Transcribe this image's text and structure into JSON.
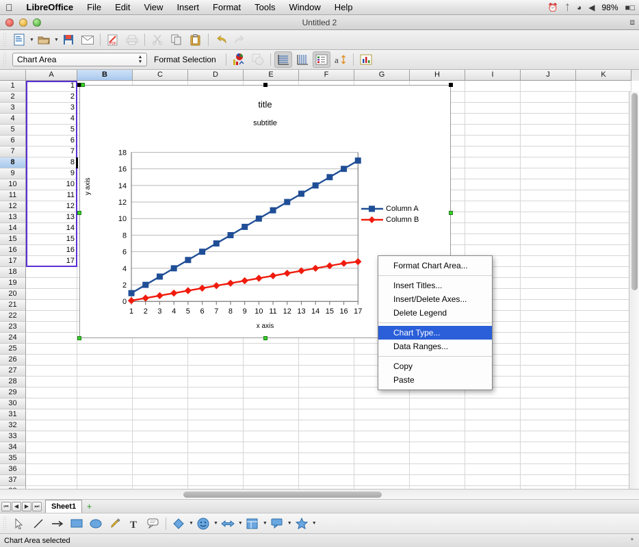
{
  "macmenu": {
    "apple": "&#63743;",
    "items": [
      {
        "label": "LibreOffice",
        "bold": true
      },
      {
        "label": "File",
        "bold": false
      },
      {
        "label": "Edit",
        "bold": false
      },
      {
        "label": "View",
        "bold": false
      },
      {
        "label": "Insert",
        "bold": false
      },
      {
        "label": "Format",
        "bold": false
      },
      {
        "label": "Tools",
        "bold": false
      },
      {
        "label": "Window",
        "bold": false
      },
      {
        "label": "Help",
        "bold": false
      }
    ],
    "status_icons": [
      "time-machine-icon",
      "bluetooth-icon",
      "wifi-icon",
      "volume-icon"
    ],
    "battery_percent": "98%"
  },
  "window": {
    "title": "Untitled 2",
    "traffic_lights": [
      "close-button",
      "minimize-button",
      "zoom-button"
    ],
    "fullscreen_icon": "fullscreen-icon"
  },
  "toolbar_main": {
    "buttons": [
      {
        "name": "new-document-button",
        "icon": "new-doc-icon",
        "dropdown": true
      },
      {
        "name": "open-document-button",
        "icon": "folder-icon",
        "dropdown": true
      },
      {
        "name": "save-button",
        "icon": "floppy-disk-icon",
        "dropdown": false
      },
      {
        "name": "email-button",
        "icon": "envelope-icon",
        "dropdown": false
      },
      {
        "name": "export-pdf-button",
        "icon": "pdf-icon",
        "dropdown": false
      },
      {
        "name": "print-button",
        "icon": "printer-icon",
        "dropdown": false
      },
      {
        "name": "cut-button",
        "icon": "scissors-icon",
        "dropdown": false
      },
      {
        "name": "copy-button",
        "icon": "copy-icon",
        "dropdown": false
      },
      {
        "name": "paste-button",
        "icon": "clipboard-icon",
        "dropdown": false
      },
      {
        "name": "undo-button",
        "icon": "undo-arrow-icon",
        "dropdown": false
      },
      {
        "name": "redo-button",
        "icon": "redo-arrow-icon",
        "dropdown": false
      }
    ]
  },
  "toolbar_chart": {
    "selection_value": "Chart Area",
    "format_selection_label": "Format Selection",
    "buttons": [
      {
        "name": "chart-data-table-button",
        "icon": "chart-colors-icon"
      },
      {
        "name": "chart-3d-view-button",
        "icon": "overlap-shapes-icon"
      },
      {
        "name": "horizontal-grids-button",
        "icon": "horizontal-grid-icon",
        "pressed": true
      },
      {
        "name": "vertical-grids-button",
        "icon": "vertical-grid-icon",
        "pressed": false
      },
      {
        "name": "legend-on-off-button",
        "icon": "legend-icon",
        "pressed": true
      },
      {
        "name": "text-direction-button",
        "icon": "text-vertical-icon",
        "pressed": false
      },
      {
        "name": "chart-type-button",
        "icon": "bar-chart-icon",
        "pressed": false
      }
    ]
  },
  "spreadsheet": {
    "columns": [
      "A",
      "B",
      "C",
      "D",
      "E",
      "F",
      "G",
      "H",
      "I",
      "J",
      "K"
    ],
    "active_column": "B",
    "active_row": 8,
    "first_row": 1,
    "last_row": 38,
    "column_a_values": [
      "1",
      "2",
      "3",
      "4",
      "5",
      "6",
      "7",
      "8",
      "9",
      "10",
      "11",
      "12",
      "13",
      "14",
      "15",
      "16",
      "17"
    ]
  },
  "chart_data": {
    "type": "line",
    "title": "title",
    "subtitle": "subtitle",
    "xlabel": "x axis",
    "ylabel": "y axis",
    "grid": "horizontal",
    "legend_position": "right",
    "x": [
      1,
      2,
      3,
      4,
      5,
      6,
      7,
      8,
      9,
      10,
      11,
      12,
      13,
      14,
      15,
      16,
      17
    ],
    "xlim": [
      1,
      17
    ],
    "ylim": [
      0,
      18
    ],
    "yticks": [
      0,
      2,
      4,
      6,
      8,
      10,
      12,
      14,
      16,
      18
    ],
    "series": [
      {
        "name": "Column A",
        "color": "#1f4e96",
        "marker": "square",
        "values": [
          1,
          2,
          3,
          4,
          5,
          6,
          7,
          8,
          9,
          10,
          11,
          12,
          13,
          14,
          15,
          16,
          17
        ]
      },
      {
        "name": "Column B",
        "color": "#f01b0d",
        "marker": "diamond",
        "values": [
          0.1,
          0.4,
          0.7,
          1.0,
          1.3,
          1.6,
          1.9,
          2.2,
          2.5,
          2.8,
          3.1,
          3.4,
          3.7,
          4.0,
          4.3,
          4.6,
          4.8
        ]
      }
    ]
  },
  "context_menu": {
    "items": [
      {
        "label": "Format Chart Area...",
        "highlighted": false,
        "separator_after": true
      },
      {
        "label": "Insert Titles...",
        "highlighted": false,
        "separator_after": false
      },
      {
        "label": "Insert/Delete Axes...",
        "highlighted": false,
        "separator_after": false
      },
      {
        "label": "Delete Legend",
        "highlighted": false,
        "separator_after": true
      },
      {
        "label": "Chart Type...",
        "highlighted": true,
        "separator_after": false
      },
      {
        "label": "Data Ranges...",
        "highlighted": false,
        "separator_after": true
      },
      {
        "label": "Copy",
        "highlighted": false,
        "separator_after": false
      },
      {
        "label": "Paste",
        "highlighted": false,
        "separator_after": false
      }
    ]
  },
  "sheet_tabs": {
    "nav_buttons": [
      "first-sheet-button",
      "previous-sheet-button",
      "next-sheet-button",
      "last-sheet-button"
    ],
    "tabs": [
      "Sheet1"
    ],
    "add_sheet_label": "+"
  },
  "drawing_toolbar": {
    "tools": [
      {
        "name": "select-tool",
        "icon": "cursor-arrow-icon",
        "dropdown": false
      },
      {
        "name": "line-tool",
        "icon": "line-icon",
        "dropdown": false
      },
      {
        "name": "arrow-tool",
        "icon": "arrow-icon",
        "dropdown": false
      },
      {
        "name": "rectangle-tool",
        "icon": "rectangle-icon",
        "dropdown": false
      },
      {
        "name": "ellipse-tool",
        "icon": "ellipse-icon",
        "dropdown": false
      },
      {
        "name": "freeform-line-tool",
        "icon": "pencil-icon",
        "dropdown": false
      },
      {
        "name": "text-box-tool",
        "icon": "text-t-icon",
        "dropdown": false
      },
      {
        "name": "callouts-tool",
        "icon": "speech-bubble-icon",
        "dropdown": false
      },
      {
        "name": "basic-shapes-tool",
        "icon": "diamond-icon",
        "dropdown": true
      },
      {
        "name": "symbol-shapes-tool",
        "icon": "smiley-icon",
        "dropdown": true
      },
      {
        "name": "block-arrows-tool",
        "icon": "double-arrow-icon",
        "dropdown": true
      },
      {
        "name": "flowchart-tool",
        "icon": "flowchart-icon",
        "dropdown": true
      },
      {
        "name": "callout-shapes-tool",
        "icon": "callout-icon",
        "dropdown": true
      },
      {
        "name": "stars-tool",
        "icon": "star-icon",
        "dropdown": true
      }
    ]
  },
  "statusbar": {
    "message": "Chart Area selected",
    "right_indicator": "*"
  }
}
